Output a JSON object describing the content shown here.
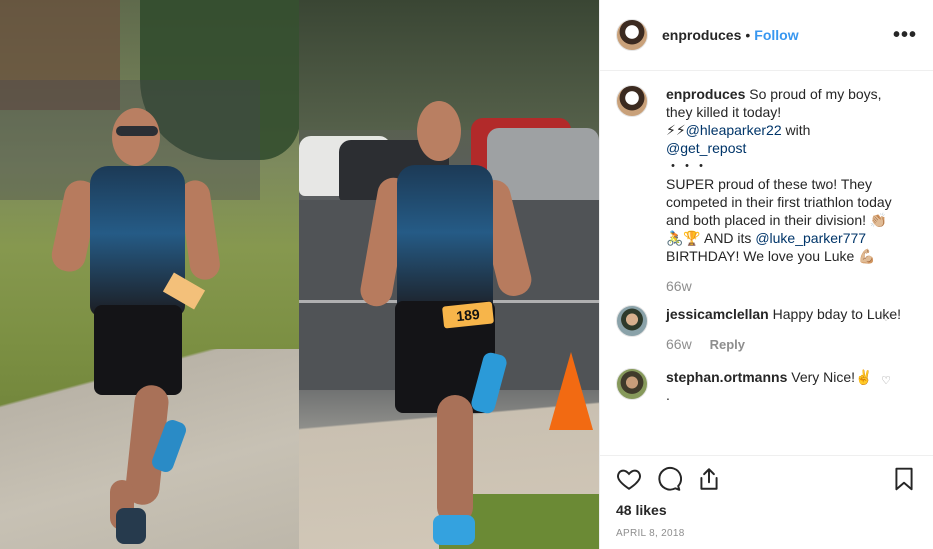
{
  "post": {
    "username": "enproduces",
    "follow_label": "Follow",
    "more_label": "•••",
    "caption": {
      "username": "enproduces",
      "line1": "So proud of my boys, they killed it today!",
      "line2_prefix": "⚡⚡",
      "mention1": "@hleaparker22",
      "line2_suffix": "with",
      "mention2": "@get_repost",
      "dots": "・・・",
      "line3": "SUPER proud of these two! They competed in their first triathlon today and both placed in their division! 👏🏼",
      "line4_prefix": "🚴🏆 AND its",
      "mention3": "@luke_parker777",
      "line4_suffix": "BIRTHDAY! We love you Luke 💪🏼",
      "time": "66w"
    },
    "comments": [
      {
        "username": "jessicamclellan",
        "text": "Happy bday to Luke!",
        "time": "66w",
        "reply_label": "Reply"
      },
      {
        "username": "stephan.ortmanns",
        "text": "Very Nice!✌️",
        "text2": "."
      }
    ],
    "likes": "48 likes",
    "date": "APRIL 8, 2018",
    "bib_number": "189"
  }
}
